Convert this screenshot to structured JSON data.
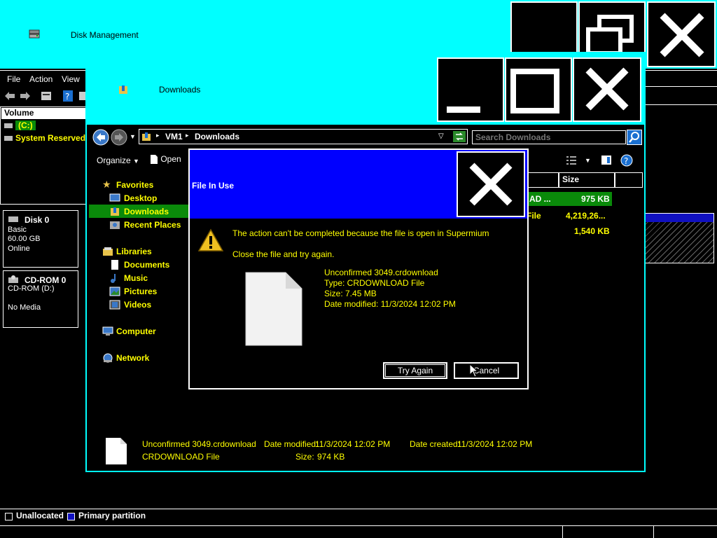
{
  "disk_management": {
    "title": "Disk Management",
    "menu": [
      "File",
      "Action",
      "View"
    ],
    "volume_header": "Volume",
    "volumes": [
      "(C:)",
      "System Reserved"
    ],
    "disks": [
      {
        "name": "Disk 0",
        "lines": [
          "Basic",
          "60.00 GB",
          "Online"
        ]
      },
      {
        "name": "CD-ROM 0",
        "lines": [
          "CD-ROM (D:)",
          "",
          "No Media"
        ]
      }
    ],
    "legend": {
      "unallocated": "Unallocated",
      "primary": "Primary partition"
    },
    "colors": {
      "unallocated": "#000000",
      "primary": "#1010c0"
    }
  },
  "explorer": {
    "title": "Downloads",
    "breadcrumb": [
      "VM1",
      "Downloads"
    ],
    "search_placeholder": "Search Downloads",
    "commands": {
      "organize": "Organize",
      "open": "Open"
    },
    "nav": {
      "favorites": "Favorites",
      "desktop": "Desktop",
      "downloads": "Downloads",
      "recent": "Recent Places",
      "libraries": "Libraries",
      "documents": "Documents",
      "music": "Music",
      "pictures": "Pictures",
      "videos": "Videos",
      "computer": "Computer",
      "network": "Network"
    },
    "columns": {
      "size": "Size"
    },
    "files": [
      {
        "type": "AD ...",
        "size": "975 KB"
      },
      {
        "type": "File",
        "size": "4,219,26..."
      },
      {
        "type": "",
        "size": "1,540 KB"
      }
    ],
    "details": {
      "name": "Unconfirmed 3049.crdownload",
      "modified_label": "Date modified:",
      "modified": "11/3/2024 12:02 PM",
      "created_label": "Date created:",
      "created": "11/3/2024 12:02 PM",
      "type": "CRDOWNLOAD File",
      "size_label": "Size:",
      "size": "974 KB"
    }
  },
  "dialog": {
    "title": "File In Use",
    "message": "The action can't be completed because the file is open in Supermium",
    "instruction": "Close the file and try again.",
    "file_name": "Unconfirmed 3049.crdownload",
    "file_type": "Type: CRDOWNLOAD File",
    "file_size": "Size: 7.45 MB",
    "file_modified": "Date modified: 11/3/2024 12:02 PM",
    "try_again": "Try Again",
    "cancel": "Cancel"
  },
  "colors": {
    "title_bar": "#00ffff",
    "dialog_title": "#0000ff",
    "selection": "#0a8a0a",
    "text_highlight": "#ffff00"
  }
}
